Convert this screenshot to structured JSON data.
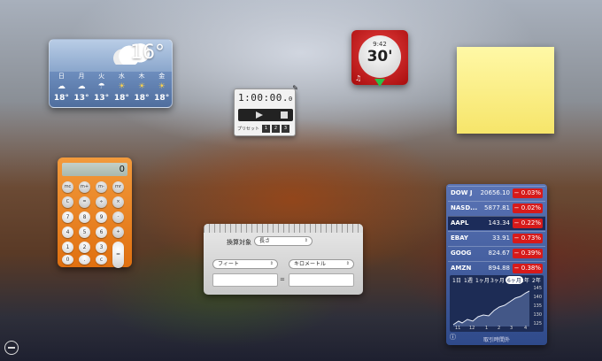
{
  "weather": {
    "temperature": "16°",
    "days": [
      {
        "day": "日",
        "icon": "cloudy-icon",
        "temp": "18°"
      },
      {
        "day": "月",
        "icon": "cloudy-icon",
        "temp": "13°"
      },
      {
        "day": "火",
        "icon": "rain-icon",
        "temp": "13°"
      },
      {
        "day": "水",
        "icon": "partly-sunny-icon",
        "temp": "18°"
      },
      {
        "day": "木",
        "icon": "partly-sunny-icon",
        "temp": "18°"
      },
      {
        "day": "金",
        "icon": "partly-sunny-icon",
        "temp": "18°"
      }
    ]
  },
  "stopwatch": {
    "display": "1:00:00.",
    "display_fraction": "0",
    "preset_label": "プリセット",
    "presets": [
      "1",
      "2",
      "3"
    ]
  },
  "timer": {
    "clock": "9:42",
    "remaining": "30'",
    "accent": "#d62020"
  },
  "calculator": {
    "display": "0",
    "keys": [
      {
        "label": "mc",
        "fn": true
      },
      {
        "label": "m+",
        "fn": true
      },
      {
        "label": "m-",
        "fn": true
      },
      {
        "label": "mr",
        "fn": true
      },
      {
        "label": "C",
        "fn": true
      },
      {
        "label": "=",
        "fn": true
      },
      {
        "label": "÷",
        "fn": true
      },
      {
        "label": "×",
        "fn": true
      },
      {
        "label": "7"
      },
      {
        "label": "8"
      },
      {
        "label": "9"
      },
      {
        "label": "-",
        "fn": true
      },
      {
        "label": "4"
      },
      {
        "label": "5"
      },
      {
        "label": "6"
      },
      {
        "label": "+",
        "fn": true
      },
      {
        "label": "1"
      },
      {
        "label": "2"
      },
      {
        "label": "3"
      },
      {
        "label": "="
      },
      {
        "label": "0"
      },
      {
        "label": "."
      },
      {
        "label": "c"
      }
    ]
  },
  "converter": {
    "label": "換算対象",
    "category": "長さ",
    "from_unit": "フィート",
    "to_unit": "キロメートル",
    "from_value": "",
    "to_value": "",
    "equals": "="
  },
  "stocks": {
    "rows": [
      {
        "symbol": "DOW J",
        "price": "20656.10",
        "change": "− 0.03%"
      },
      {
        "symbol": "NASD...",
        "price": "5877.81",
        "change": "− 0.02%"
      },
      {
        "symbol": "AAPL",
        "price": "143.34",
        "change": "− 0.22%"
      },
      {
        "symbol": "EBAY",
        "price": "33.91",
        "change": "− 0.73%"
      },
      {
        "symbol": "GOOG",
        "price": "824.67",
        "change": "− 0.39%"
      },
      {
        "symbol": "AMZN",
        "price": "894.88",
        "change": "− 0.38%"
      }
    ],
    "ranges": [
      "1日",
      "1週",
      "1ヶ月",
      "3ヶ月",
      "6ヶ月",
      "1年",
      "2年"
    ],
    "y_labels": [
      "145",
      "140",
      "135",
      "130",
      "125"
    ],
    "x_labels": [
      "11",
      "12",
      "1",
      "2",
      "3",
      "4"
    ],
    "footer": "取引時間外",
    "info": "ⓘ",
    "down_color": "#d61a1a"
  }
}
